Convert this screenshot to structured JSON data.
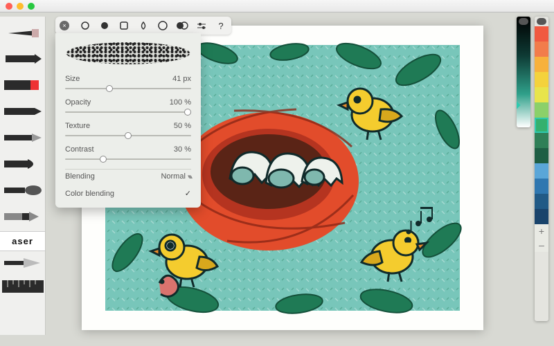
{
  "window": {
    "title": ""
  },
  "toolbar": {
    "brushPresets": [
      {
        "name": "circle-outline"
      },
      {
        "name": "circle-filled"
      },
      {
        "name": "square-outline"
      },
      {
        "name": "teardrop"
      },
      {
        "name": "ring-outline"
      },
      {
        "name": "overlap-circles"
      },
      {
        "name": "sliders-icon"
      },
      {
        "name": "help-icon",
        "label": "?"
      }
    ]
  },
  "brushPanel": {
    "sliders": [
      {
        "label": "Size",
        "value": "41 px",
        "pct": 35
      },
      {
        "label": "Opacity",
        "value": "100 %",
        "pct": 100
      },
      {
        "label": "Texture",
        "value": "50 %",
        "pct": 50
      },
      {
        "label": "Contrast",
        "value": "30 %",
        "pct": 30
      }
    ],
    "blending": {
      "label": "Blending",
      "value": "Normal"
    },
    "colorBlending": {
      "label": "Color blending",
      "checked": true
    }
  },
  "tools": {
    "items": [
      "pencil-tool",
      "pen-tool",
      "marker-tool",
      "marker-red-tool",
      "liner-tool",
      "fine-pen-tool",
      "nib-tool",
      "brush-tool",
      "utility-tool"
    ],
    "eraserLabel": "aser"
  },
  "swatches": {
    "gradient": {
      "markerTopPx": 124
    },
    "colors": [
      "#f05940",
      "#f27c4b",
      "#f7b13c",
      "#f4d23c",
      "#e8e44b",
      "#8bd06a",
      "#34b06e",
      "#2f7f57",
      "#1e5e44",
      "#5aa6d8",
      "#2f77b0",
      "#215a86",
      "#19436b"
    ],
    "selectedIndex": 6,
    "plus": "+",
    "minus": "–"
  },
  "artwork": {
    "bg": "#78c6ba",
    "leaf": "#1f7a55",
    "leafDark": "#14503a",
    "nest": "#e24c2b",
    "nestDark": "#b53420",
    "bird": "#f4cc2e",
    "birdShade": "#d8a81d",
    "eggShell": "#eef2ec",
    "eggInner": "#7fb8ae",
    "outline": "#102a2a",
    "worm": "#d9736e"
  }
}
